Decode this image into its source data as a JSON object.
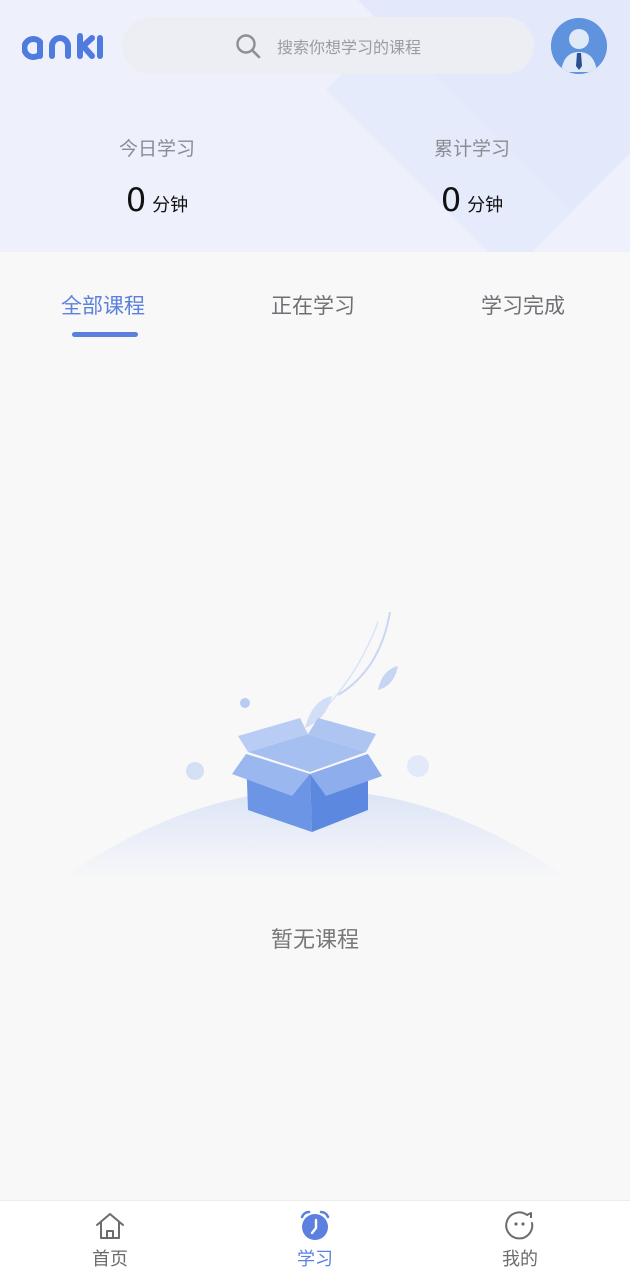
{
  "header": {
    "search_placeholder": "搜索你想学习的课程",
    "today": {
      "label": "今日学习",
      "value": "0",
      "unit": "分钟"
    },
    "total": {
      "label": "累计学习",
      "value": "0",
      "unit": "分钟"
    }
  },
  "tabs": [
    {
      "label": "全部课程",
      "active": true
    },
    {
      "label": "正在学习",
      "active": false
    },
    {
      "label": "学习完成",
      "active": false
    }
  ],
  "empty": {
    "message": "暂无课程"
  },
  "bottom_nav": [
    {
      "label": "首页",
      "icon": "home-icon",
      "active": false
    },
    {
      "label": "学习",
      "icon": "alarm-clock-icon",
      "active": true
    },
    {
      "label": "我的",
      "icon": "face-icon",
      "active": false
    }
  ],
  "colors": {
    "accent": "#5b80df",
    "header_bg": "#eef1fb",
    "page_bg": "#f8f8f9"
  }
}
